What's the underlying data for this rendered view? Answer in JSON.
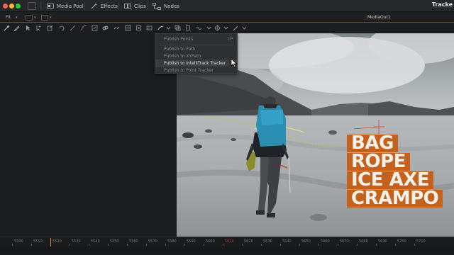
{
  "topbar": {
    "tabs": [
      {
        "label": "Media Pool",
        "icon": "media-pool-icon"
      },
      {
        "label": "Effects",
        "icon": "effects-icon"
      },
      {
        "label": "Clips",
        "icon": "clips-icon"
      },
      {
        "label": "Nodes",
        "icon": "nodes-icon"
      }
    ],
    "app_title": "Tracke"
  },
  "viewer": {
    "zoom": "Fit",
    "output_name": "MediaOut1"
  },
  "menu": {
    "items": [
      {
        "label": "Publish Points",
        "shortcut": "⇧P",
        "highlighted": false
      },
      {
        "label": "Publish to Path",
        "highlighted": false
      },
      {
        "label": "Publish to XYPath",
        "highlighted": false
      },
      {
        "label": "Publish to IntelliTrack Tracker",
        "highlighted": true
      },
      {
        "label": "Publish to Point Tracker",
        "highlighted": false
      }
    ]
  },
  "overlay": {
    "lines": [
      "BAG",
      "ROPE",
      "ICE AXE",
      "CRAMPO"
    ],
    "color": "#c4621d"
  },
  "timeline": {
    "ticks": [
      "5500",
      "5510",
      "5520",
      "5530",
      "5540",
      "5550",
      "5560",
      "5570",
      "5580",
      "5590",
      "5600",
      "5610",
      "5620",
      "5630",
      "5640",
      "5650",
      "5660",
      "5670",
      "5680",
      "5690",
      "5700",
      "5710"
    ],
    "highlight_tick": "5610"
  },
  "colors": {
    "accent_red": "#b32a2a",
    "playhead": "#e08c1a"
  }
}
